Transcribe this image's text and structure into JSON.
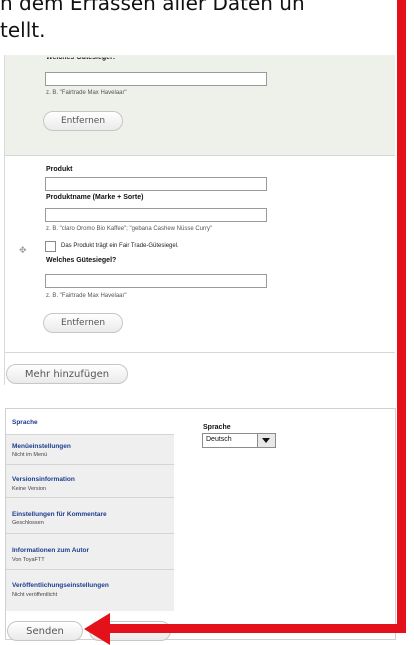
{
  "intro": {
    "line1": "n dem Erfassen aller Daten un",
    "line2": "tellt."
  },
  "block1": {
    "label": "Welches Gütesiegel?",
    "hint": "z. B. \"Fairtrade Max Havelaar\"",
    "remove_label": "Entfernen"
  },
  "block2": {
    "product_label": "Produkt",
    "product_name_label": "Produktname (Marke + Sorte)",
    "product_name_hint": "z. B. \"claro Oromo Bio Kaffee\"; \"gebana Cashew Nüsse Curry\"",
    "checkbox_label": "Das Produkt trägt ein Fair Trade-Gütesiegel.",
    "seal_label": "Welches Gütesiegel?",
    "seal_hint": "z. B. \"Fairtrade Max Havelaar\"",
    "remove_label": "Entfernen",
    "drag_icon": "move-cross-icon"
  },
  "add_more_label": "Mehr hinzufügen",
  "vertical_tabs": {
    "items": [
      {
        "title": "Sprache",
        "summary": ""
      },
      {
        "title": "Menüeinstellungen",
        "summary": "Nicht im Menü"
      },
      {
        "title": "Versionsinformation",
        "summary": "Keine Version"
      },
      {
        "title": "Einstellungen für Kommentare",
        "summary": "Geschlossen"
      },
      {
        "title": "Informationen zum Autor",
        "summary": "Von ToyaFTT"
      },
      {
        "title": "Veröffentlichungseinstellungen",
        "summary": "Nicht veröffentlicht"
      }
    ],
    "pane": {
      "label": "Sprache",
      "select_value": "Deutsch"
    }
  },
  "submit_label": "Senden",
  "annotation": {
    "color": "#e4111b"
  }
}
